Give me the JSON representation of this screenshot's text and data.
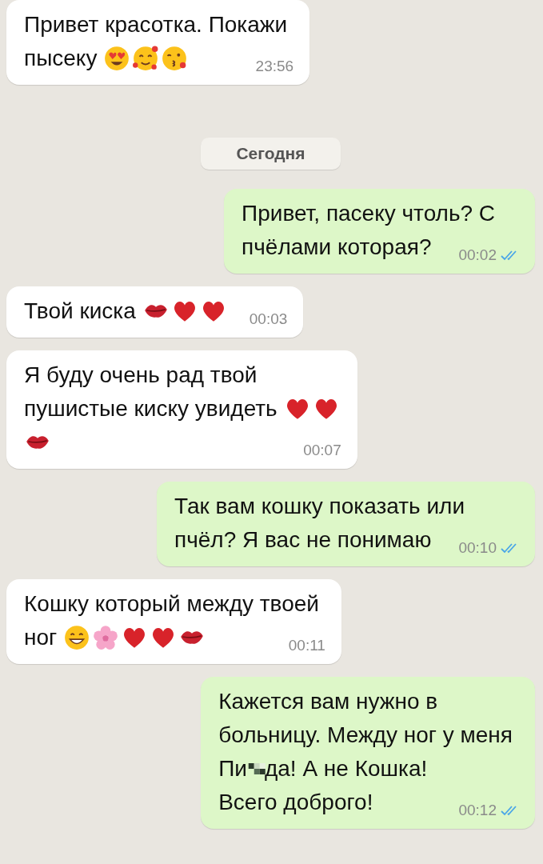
{
  "messages": [
    {
      "kind": "incoming",
      "lines": [
        [
          {
            "kind": "text",
            "text": "Привет красотка. Покажи"
          }
        ],
        [
          {
            "kind": "text",
            "text": "пысеку"
          },
          {
            "kind": "heart_eyes"
          },
          {
            "kind": "smile_hearts"
          },
          {
            "kind": "kiss_face"
          }
        ]
      ],
      "time": "23:56"
    },
    {
      "kind": "date",
      "label": "Сегодня"
    },
    {
      "kind": "outgoing",
      "lines": [
        [
          {
            "kind": "text",
            "text": "Привет, пасеку чтоль? С"
          }
        ],
        [
          {
            "kind": "text",
            "text": "пчёлами которая?"
          }
        ]
      ],
      "time": "00:02",
      "read": true
    },
    {
      "kind": "incoming",
      "lines": [
        [
          {
            "kind": "text",
            "text": "Твой киска"
          },
          {
            "kind": "lips"
          },
          {
            "kind": "heart"
          },
          {
            "kind": "heart"
          }
        ]
      ],
      "time": "00:03"
    },
    {
      "kind": "incoming",
      "lines": [
        [
          {
            "kind": "text",
            "text": "Я буду очень рад твой"
          }
        ],
        [
          {
            "kind": "text",
            "text": "пушистые киску увидеть"
          },
          {
            "kind": "heart"
          },
          {
            "kind": "heart"
          }
        ],
        [
          {
            "kind": "lips"
          }
        ]
      ],
      "time": "00:07"
    },
    {
      "kind": "outgoing",
      "lines": [
        [
          {
            "kind": "text",
            "text": "Так вам кошку показать или"
          }
        ],
        [
          {
            "kind": "text",
            "text": "пчёл? Я вас не понимаю"
          }
        ]
      ],
      "time": "00:10",
      "read": true
    },
    {
      "kind": "incoming",
      "lines": [
        [
          {
            "kind": "text",
            "text": "Кошку который между твоей"
          }
        ],
        [
          {
            "kind": "text",
            "text": "ног"
          },
          {
            "kind": "grin"
          },
          {
            "kind": "flower"
          },
          {
            "kind": "heart"
          },
          {
            "kind": "heart"
          },
          {
            "kind": "lips"
          }
        ]
      ],
      "time": "00:11"
    },
    {
      "kind": "outgoing",
      "lines": [
        [
          {
            "kind": "text",
            "text": "Кажется вам нужно в"
          }
        ],
        [
          {
            "kind": "text",
            "text": "больницу. Между ног у меня"
          }
        ],
        [
          {
            "kind": "text",
            "text": "Пи"
          },
          {
            "kind": "censor"
          },
          {
            "kind": "text",
            "text": "да! А не Кошка!"
          }
        ],
        [
          {
            "kind": "text",
            "text": "Всего доброго!"
          }
        ]
      ],
      "time": "00:12",
      "read": true
    }
  ]
}
